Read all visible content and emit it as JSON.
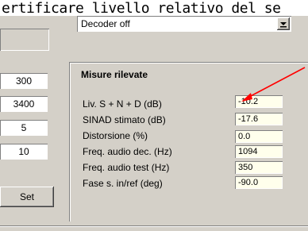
{
  "caption": "ertificare livello relativo del se",
  "combo": {
    "value": "Decoder off",
    "arrow_icon": "chevron-down-icon"
  },
  "left_fields": [
    "300",
    "3400",
    "5",
    "10"
  ],
  "set_button": "Set",
  "measures": {
    "title": "Misure rilevate",
    "rows": [
      {
        "label": "Liv. S + N + D  (dB)",
        "value": "-10.2"
      },
      {
        "label": "SINAD stimato  (dB)",
        "value": "-17.6"
      },
      {
        "label": "Distorsione  (%)",
        "value": "0.0"
      },
      {
        "label": "Freq. audio dec.  (Hz)",
        "value": "1094"
      },
      {
        "label": "Freq. audio test  (Hz)",
        "value": "350"
      },
      {
        "label": "Fase s. in/ref  (deg)",
        "value": "-90.0"
      }
    ]
  },
  "colors": {
    "panel": "#d4d0c8",
    "value_bg": "#ffffec",
    "arrow": "#ff0000"
  }
}
